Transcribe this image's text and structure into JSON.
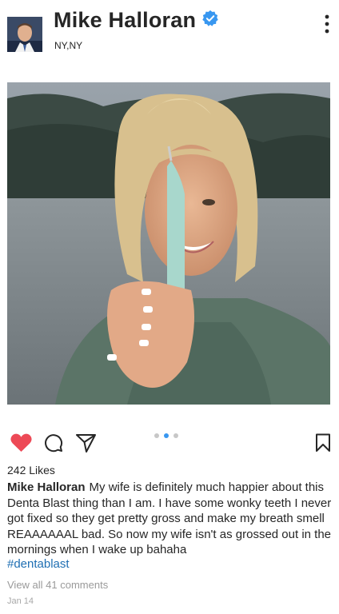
{
  "header": {
    "name": "Mike Halloran",
    "location": "NY,NY",
    "verified_color": "#3897f0"
  },
  "post": {
    "image_icon": "photo-woman-holding-tooth-cleaner",
    "carousel": {
      "count": 3,
      "active_index": 1
    }
  },
  "actions": {
    "like_icon": "heart-filled-icon",
    "comment_icon": "comment-icon",
    "share_icon": "send-icon",
    "save_icon": "bookmark-icon",
    "like_color": "#ed4956"
  },
  "likes": "242 Likes",
  "caption": {
    "author": "Mike Halloran",
    "text": "My wife is definitely much happier about this Denta Blast thing than I am. I have some wonky teeth I never got fixed so they get pretty gross and make my breath smell REAAAAAAL bad. So now my wife isn't as grossed out in the mornings when I wake up bahaha"
  },
  "hashtag": "#dentablast",
  "comments_link": "View all 41 comments",
  "date": "Jan 14"
}
